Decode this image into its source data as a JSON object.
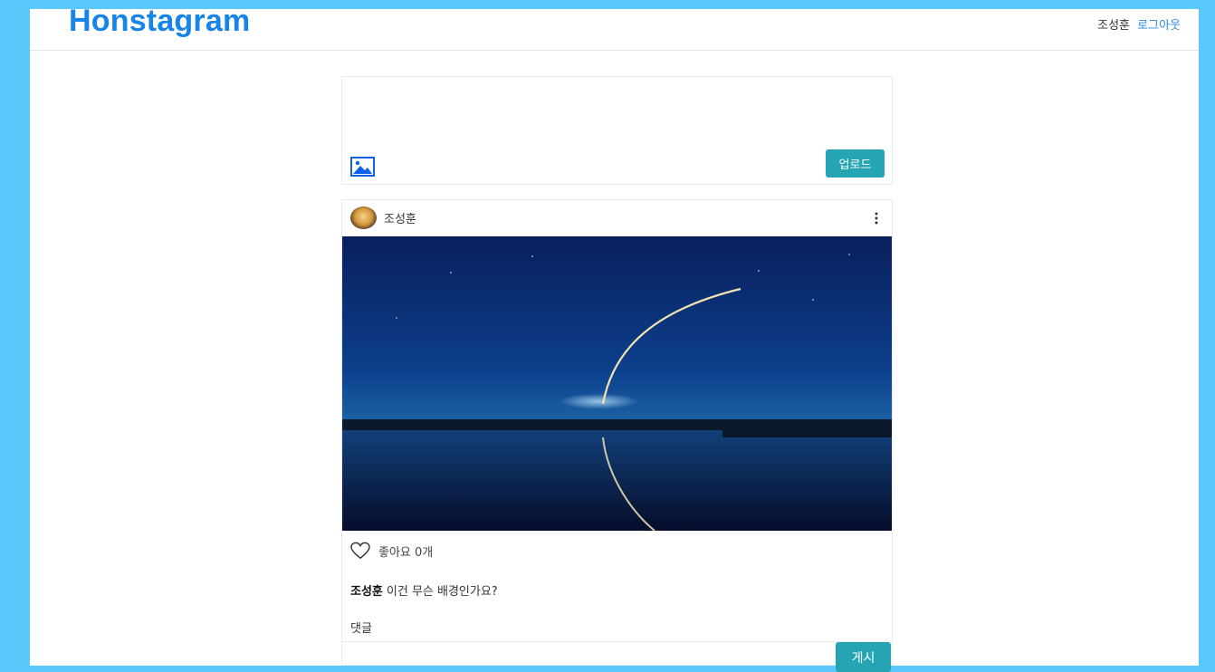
{
  "navbar": {
    "brand": "Honstagram",
    "user_name": "조성훈",
    "logout_label": "로그아웃"
  },
  "upload": {
    "upload_button": "업로드",
    "image_icon": "image-icon"
  },
  "post": {
    "author": "조성훈",
    "more_icon": "vertical-dots-icon",
    "image_description": "rocket-launch-trail-night-lake",
    "heart_icon": "heart-outline-icon",
    "likes_text": "좋아요 0개",
    "caption_author": "조성훈",
    "caption_text": "이건 무슨 배경인가요?",
    "comment_label": "댓글",
    "comment_placeholder": "",
    "post_button": "게시"
  },
  "colors": {
    "background": "#5bc8fb",
    "brand": "#1785e8",
    "button": "#25a4b3",
    "link": "#2a8be0"
  }
}
